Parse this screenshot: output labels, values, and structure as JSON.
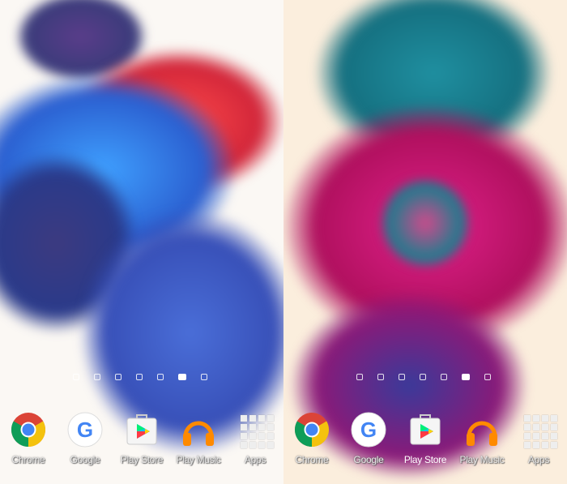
{
  "screens": [
    {
      "name": "left",
      "page_count": 7,
      "active_page": 5,
      "apps": [
        {
          "label": "Chrome",
          "icon": "chrome-icon"
        },
        {
          "label": "Google",
          "icon": "google-icon"
        },
        {
          "label": "Play Store",
          "icon": "play-store-icon"
        },
        {
          "label": "Play Music",
          "icon": "play-music-icon"
        },
        {
          "label": "Apps",
          "icon": "app-drawer-icon"
        }
      ]
    },
    {
      "name": "right",
      "page_count": 7,
      "active_page": 5,
      "apps": [
        {
          "label": "Chrome",
          "icon": "chrome-icon"
        },
        {
          "label": "Google",
          "icon": "google-icon"
        },
        {
          "label": "Play Store",
          "icon": "play-store-icon"
        },
        {
          "label": "Play Music",
          "icon": "play-music-icon"
        },
        {
          "label": "Apps",
          "icon": "app-drawer-icon"
        }
      ]
    }
  ],
  "colors": {
    "left_bg": "#fbf8f4",
    "right_bg": "#fbeedd",
    "ink_blue": "#2f6fd6",
    "ink_red": "#e0343c",
    "ink_teal": "#1f8a9a",
    "ink_magenta": "#c3166e"
  }
}
